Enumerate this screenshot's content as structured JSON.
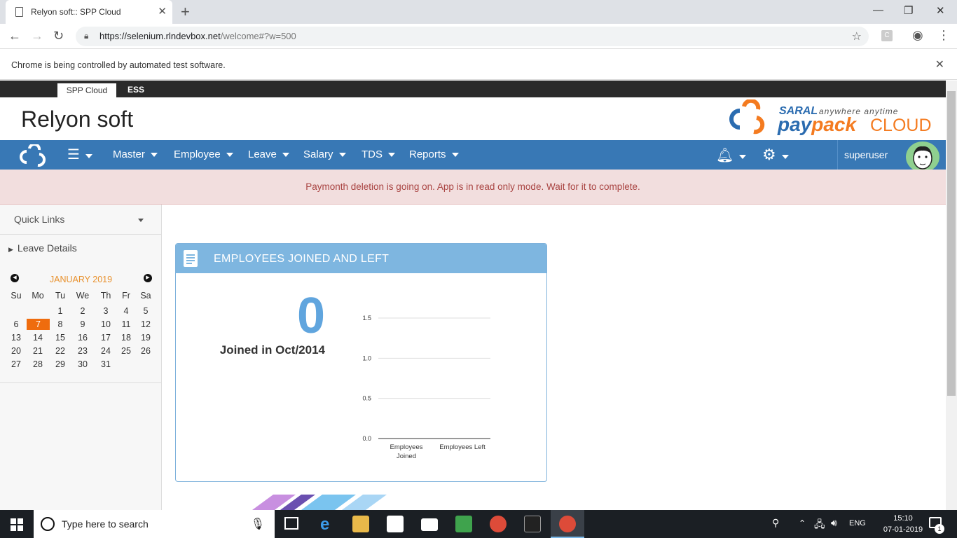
{
  "browser": {
    "tab_title": "Relyon soft:: SPP Cloud",
    "url_host": "https://selenium.rlndevbox.net",
    "url_path": "/welcome#?w=500",
    "ext_label": "C",
    "infobar_msg": "Chrome is being controlled by automated test software."
  },
  "app": {
    "top_tabs": [
      "SPP Cloud",
      "ESS"
    ],
    "company_name": "Relyon soft",
    "logo": {
      "saral": "SARAL",
      "tagline": "anywhere anytime",
      "pay": "pay",
      "pack": "pack",
      "cloud": "CLOUD"
    },
    "nav": [
      "Master",
      "Employee",
      "Leave",
      "Salary",
      "TDS",
      "Reports"
    ],
    "username": "superuser",
    "alert": "Paymonth deletion is going on. App is in read only mode. Wait for it to complete."
  },
  "sidebar": {
    "quick_links": "Quick Links",
    "leave_details": "Leave Details",
    "calendar": {
      "month": "JANUARY 2019",
      "weekdays": [
        "Su",
        "Mo",
        "Tu",
        "We",
        "Th",
        "Fr",
        "Sa"
      ],
      "weeks": [
        [
          "",
          "",
          "1",
          "2",
          "3",
          "4",
          "5"
        ],
        [
          "6",
          "7",
          "8",
          "9",
          "10",
          "11",
          "12"
        ],
        [
          "13",
          "14",
          "15",
          "16",
          "17",
          "18",
          "19"
        ],
        [
          "20",
          "21",
          "22",
          "23",
          "24",
          "25",
          "26"
        ],
        [
          "27",
          "28",
          "29",
          "30",
          "31",
          "",
          ""
        ]
      ],
      "today": "7"
    }
  },
  "card": {
    "title": "EMPLOYEES JOINED AND LEFT",
    "big_number": "0",
    "joined_label": "Joined in Oct/2014"
  },
  "chart_data": {
    "type": "bar",
    "categories": [
      "Employees Joined",
      "Employees Left"
    ],
    "values": [
      0,
      0
    ],
    "ylim": [
      0,
      1.5
    ],
    "yticks": [
      "0.0",
      "0.5",
      "1.0",
      "1.5"
    ],
    "grid": true
  },
  "taskbar": {
    "search_placeholder": "Type here to search",
    "lang": "ENG",
    "time": "15:10",
    "date": "07-01-2019",
    "notif_count": "1"
  }
}
